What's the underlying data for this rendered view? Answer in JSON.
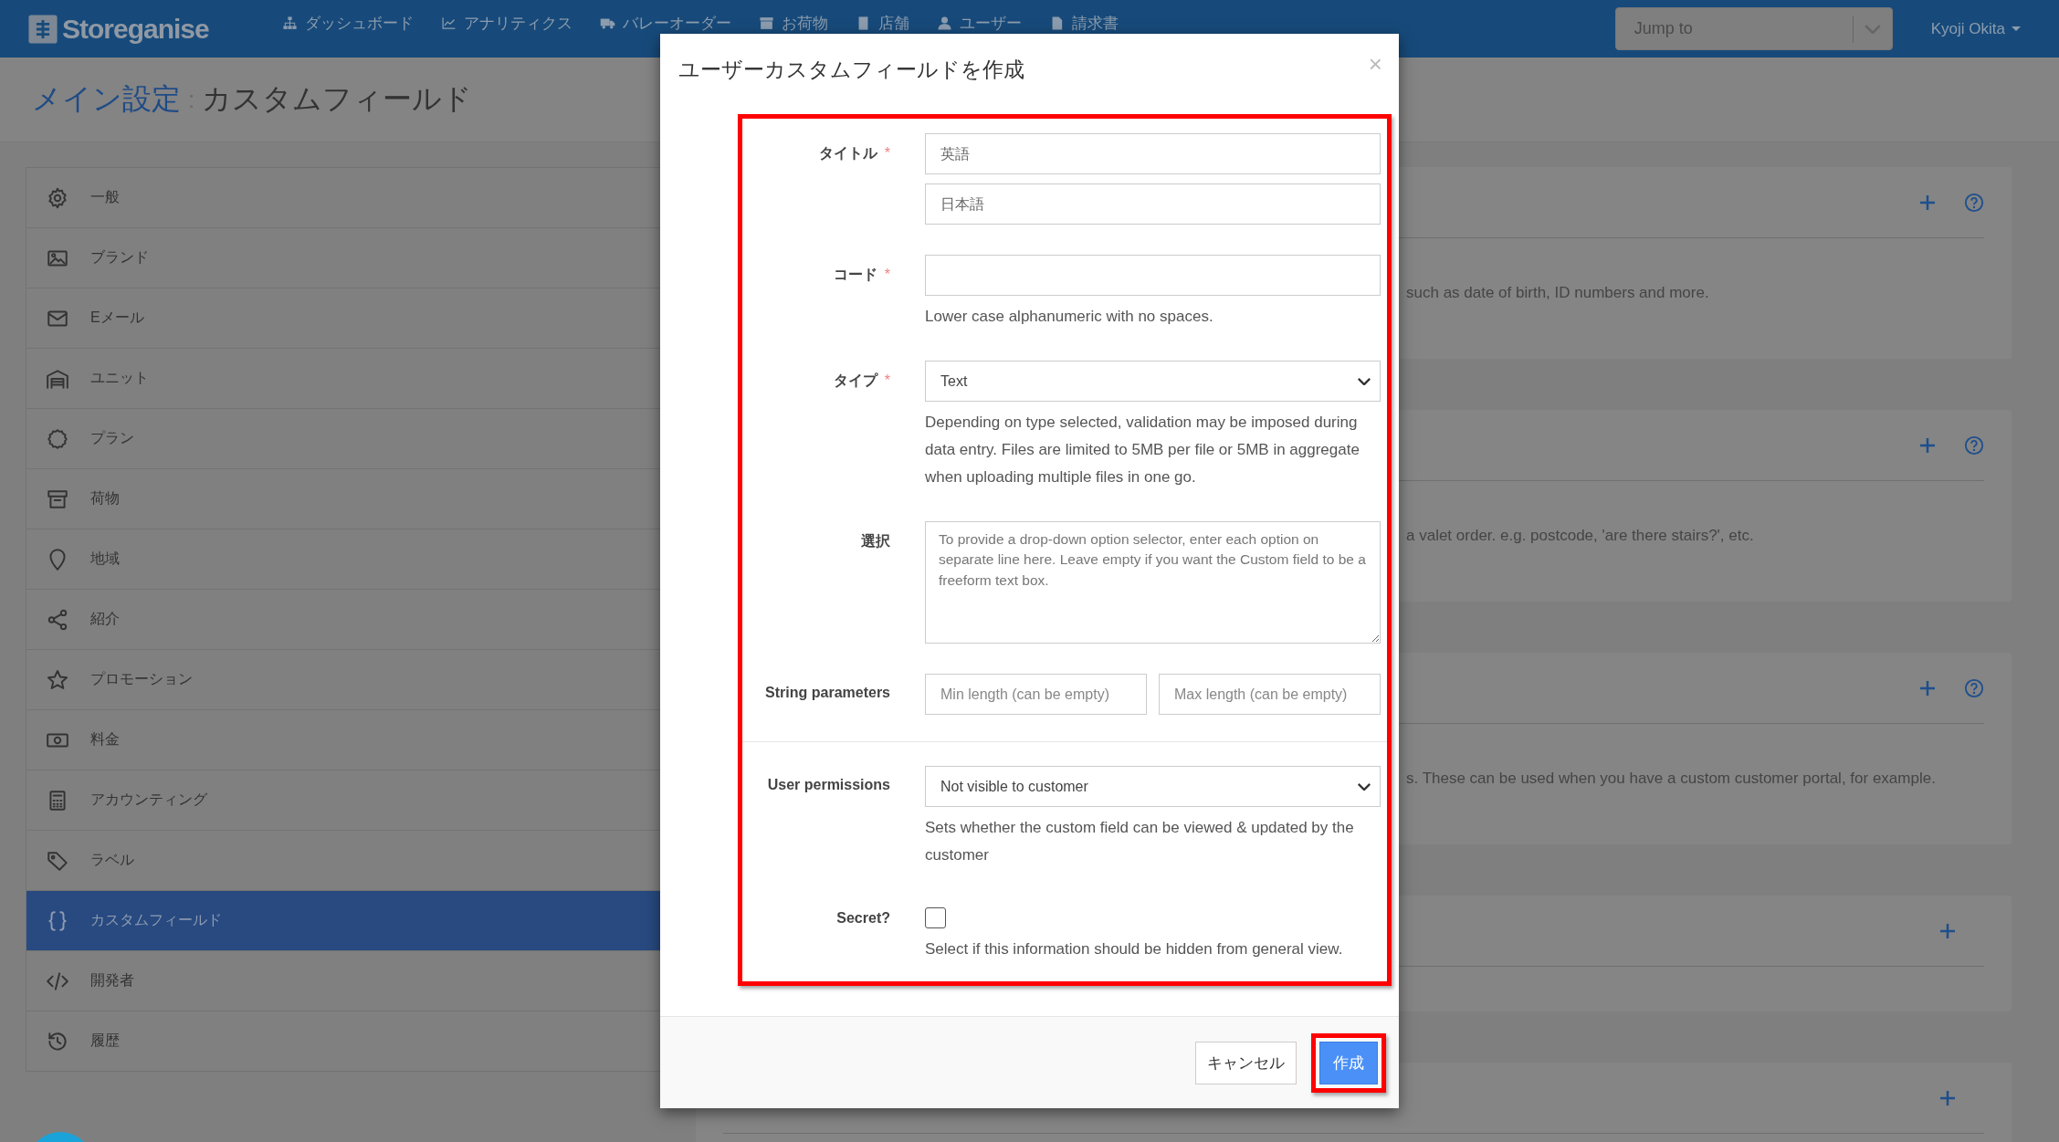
{
  "topbar": {
    "logo": "Storeganise",
    "nav": [
      {
        "label": "ダッシュボード"
      },
      {
        "label": "アナリティクス"
      },
      {
        "label": "バレーオーダー"
      },
      {
        "label": "お荷物"
      },
      {
        "label": "店舗"
      },
      {
        "label": "ユーザー"
      },
      {
        "label": "請求書"
      }
    ],
    "jump_to": {
      "placeholder": "Jump to"
    },
    "user": "Kyoji Okita"
  },
  "page_title": {
    "section": "メイン設定",
    "separator": ":",
    "page": "カスタムフィールド"
  },
  "sidebar": {
    "items": [
      {
        "label": "一般",
        "selected": false
      },
      {
        "label": "ブランド",
        "selected": false
      },
      {
        "label": "Eメール",
        "selected": false
      },
      {
        "label": "ユニット",
        "selected": false
      },
      {
        "label": "プラン",
        "selected": false
      },
      {
        "label": "荷物",
        "selected": false
      },
      {
        "label": "地域",
        "selected": false
      },
      {
        "label": "紹介",
        "selected": false
      },
      {
        "label": "プロモーション",
        "selected": false
      },
      {
        "label": "料金",
        "selected": false
      },
      {
        "label": "アカウンティング",
        "selected": false
      },
      {
        "label": "ラベル",
        "selected": false
      },
      {
        "label": "カスタムフィールド",
        "selected": true
      },
      {
        "label": "開発者",
        "selected": false
      },
      {
        "label": "履歴",
        "selected": false
      }
    ]
  },
  "panels": [
    {
      "description": "such as date of birth, ID numbers and more.",
      "help": true
    },
    {
      "description": "a valet order. e.g. postcode, 'are there stairs?', etc.",
      "help": true
    },
    {
      "description": "s. These can be used when you have a custom customer portal, for example.",
      "help": true
    },
    {
      "help": false
    },
    {
      "help": false
    }
  ],
  "modal": {
    "title": "ユーザーカスタムフィールドを作成",
    "close": "×",
    "form_highlighted": true,
    "fields": [
      {
        "kind": "stacked_inputs",
        "label": "タイトル",
        "required_mark": "*",
        "placeholders": [
          "英語",
          "日本語"
        ]
      },
      {
        "kind": "input",
        "label": "コード",
        "required_mark": "*",
        "help": "Lower case alphanumeric with no spaces."
      },
      {
        "kind": "select",
        "label": "タイプ",
        "required_mark": "*",
        "value": "Text",
        "help": "Depending on type selected, validation may be imposed during data entry. Files are limited to 5MB per file or 5MB in aggregate when uploading multiple files in one go."
      },
      {
        "kind": "textarea",
        "label": "選択",
        "placeholder": "To provide a drop-down option selector, enter each option on separate line here. Leave empty if you want the Custom field to be a freeform text box."
      },
      {
        "kind": "paired_inputs",
        "label": "String parameters",
        "placeholders": [
          "Min length (can be empty)",
          "Max length (can be empty)"
        ]
      },
      {
        "kind": "select",
        "label": "User permissions",
        "divider_before": true,
        "value": "Not visible to customer",
        "help": "Sets whether the custom field can be viewed & updated by the customer"
      },
      {
        "kind": "checkbox",
        "label": "Secret?",
        "checked": false,
        "help": "Select if this information should be hidden from general view."
      }
    ],
    "buttons": [
      {
        "label": "キャンセル",
        "kind": "default",
        "highlighted": false
      },
      {
        "label": "作成",
        "kind": "primary",
        "highlighted": true
      }
    ]
  }
}
